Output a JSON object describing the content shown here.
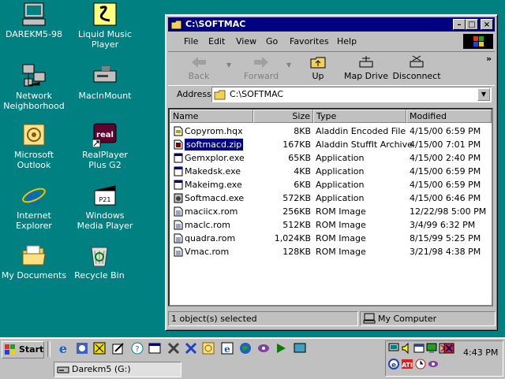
{
  "desktop": {
    "icons": [
      {
        "label": "DAREKM5-98",
        "icon": "computer-icon"
      },
      {
        "label": "Liquid Music\nPlayer",
        "icon": "liquid-music-icon"
      },
      {
        "label": "Network\nNeighborhood",
        "icon": "network-icon"
      },
      {
        "label": "MacInMount",
        "icon": "drive-icon"
      },
      {
        "label": "Microsoft\nOutlook",
        "icon": "outlook-icon"
      },
      {
        "label": "RealPlayer\nPlus G2",
        "icon": "realplayer-icon"
      },
      {
        "label": "Internet\nExplorer",
        "icon": "ie-icon"
      },
      {
        "label": "Windows\nMedia Player",
        "icon": "media-player-icon"
      },
      {
        "label": "My Documents",
        "icon": "folder-icon"
      },
      {
        "label": "Recycle Bin",
        "icon": "recycle-bin-icon"
      }
    ]
  },
  "window": {
    "title": "C:\\SOFTMAC",
    "menu": [
      "File",
      "Edit",
      "View",
      "Go",
      "Favorites",
      "Help"
    ],
    "toolbar": {
      "back": "Back",
      "forward": "Forward",
      "up": "Up",
      "map_drive": "Map Drive",
      "disconnect": "Disconnect",
      "more": "»"
    },
    "address": {
      "label": "Address",
      "value": "C:\\SOFTMAC"
    },
    "columns": [
      "Name",
      "Size",
      "Type",
      "Modified"
    ],
    "files": [
      {
        "name": "Copyrom.hqx",
        "size": "8KB",
        "type": "Aladdin Encoded File",
        "modified": "4/15/00 6:59 PM",
        "icon": "hqx-file-icon"
      },
      {
        "name": "softmacd.zip",
        "size": "167KB",
        "type": "Aladdin StuffIt Archive",
        "modified": "4/15/00 7:01 PM",
        "icon": "zip-file-icon",
        "selected": true
      },
      {
        "name": "Gemxplor.exe",
        "size": "65KB",
        "type": "Application",
        "modified": "4/15/00 2:40 PM",
        "icon": "exe-icon"
      },
      {
        "name": "Makedsk.exe",
        "size": "4KB",
        "type": "Application",
        "modified": "4/15/00 6:59 PM",
        "icon": "exe-icon"
      },
      {
        "name": "Makeimg.exe",
        "size": "6KB",
        "type": "Application",
        "modified": "4/15/00 6:59 PM",
        "icon": "exe-icon"
      },
      {
        "name": "Softmacd.exe",
        "size": "572KB",
        "type": "Application",
        "modified": "4/15/00 6:46 PM",
        "icon": "softmac-exe-icon"
      },
      {
        "name": "maciicx.rom",
        "size": "256KB",
        "type": "ROM Image",
        "modified": "12/22/98 5:00 PM",
        "icon": "rom-icon"
      },
      {
        "name": "maclc.rom",
        "size": "512KB",
        "type": "ROM Image",
        "modified": "3/4/99 6:32 PM",
        "icon": "rom-icon"
      },
      {
        "name": "quadra.rom",
        "size": "1,024KB",
        "type": "ROM Image",
        "modified": "8/15/99 5:25 PM",
        "icon": "rom-icon"
      },
      {
        "name": "Vmac.rom",
        "size": "128KB",
        "type": "ROM Image",
        "modified": "3/21/98 4:38 PM",
        "icon": "rom-icon"
      }
    ],
    "status": {
      "selection": "1 object(s) selected",
      "location": "My Computer"
    }
  },
  "taskbar": {
    "start_label": "Start",
    "task_button": "Darekm5 (G:)",
    "clock": "4:43 PM"
  },
  "colors": {
    "desktop": "#008080",
    "title_active": "#000080",
    "selection": "#000080"
  }
}
